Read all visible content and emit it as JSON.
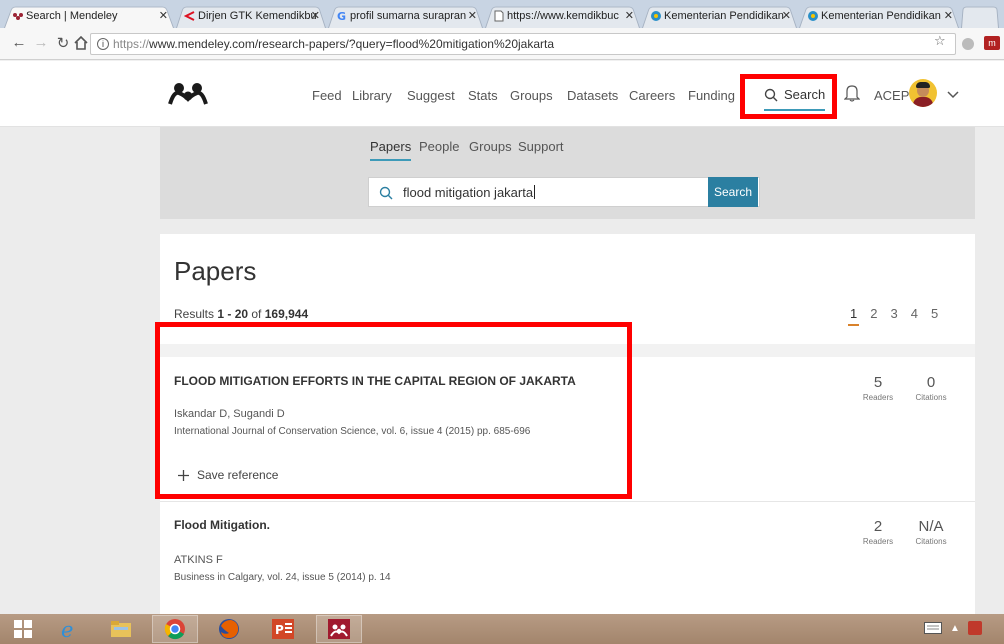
{
  "browser": {
    "tabs": [
      {
        "title": "Search | Mendeley",
        "active": true
      },
      {
        "title": "Dirjen GTK Kemendikbu",
        "active": false
      },
      {
        "title": "profil sumarna surapran",
        "active": false
      },
      {
        "title": "https://www.kemdikbuc",
        "active": false
      },
      {
        "title": "Kementerian Pendidikan",
        "active": false
      },
      {
        "title": "Kementerian Pendidikan",
        "active": false
      }
    ],
    "address": {
      "scheme": "https://",
      "rest": "www.mendeley.com/research-papers/?query=flood%20mitigation%20jakarta"
    }
  },
  "nav": {
    "links": [
      "Feed",
      "Library",
      "Suggest",
      "Stats",
      "Groups",
      "Datasets",
      "Careers",
      "Funding"
    ],
    "search_label": "Search",
    "username": "ACEP"
  },
  "search": {
    "tabs": [
      "Papers",
      "People",
      "Groups",
      "Support"
    ],
    "query": "flood mitigation jakarta",
    "button_label": "Search"
  },
  "results": {
    "heading": "Papers",
    "count_prefix": "Results ",
    "count_range": "1 - 20",
    "count_of": " of ",
    "count_total": "169,944",
    "pages": [
      "1",
      "2",
      "3",
      "4",
      "5"
    ],
    "readers_label": "Readers",
    "citations_label": "Citations",
    "save_label": "Save reference",
    "papers": [
      {
        "title": "FLOOD MITIGATION EFFORTS IN THE CAPITAL REGION OF JAKARTA",
        "authors": "Iskandar D, Sugandi D",
        "journal": "International Journal of Conservation Science, vol. 6, issue 4 (2015) pp. 685-696",
        "readers": "5",
        "citations": "0"
      },
      {
        "title": "Flood Mitigation.",
        "authors": "ATKINS F",
        "journal": "Business in Calgary, vol. 24, issue 5 (2014) p. 14",
        "readers": "2",
        "citations": "N/A"
      }
    ]
  },
  "icons": {
    "logo": "mendeley-logo",
    "search": "search-icon",
    "bell": "bell-icon",
    "caret": "chevron-down-icon",
    "add": "plus-icon"
  },
  "colors": {
    "accent": "#3d9ab8",
    "button": "#2b7fa1",
    "highlight": "#ff0000",
    "pager_active": "#d9822b"
  }
}
